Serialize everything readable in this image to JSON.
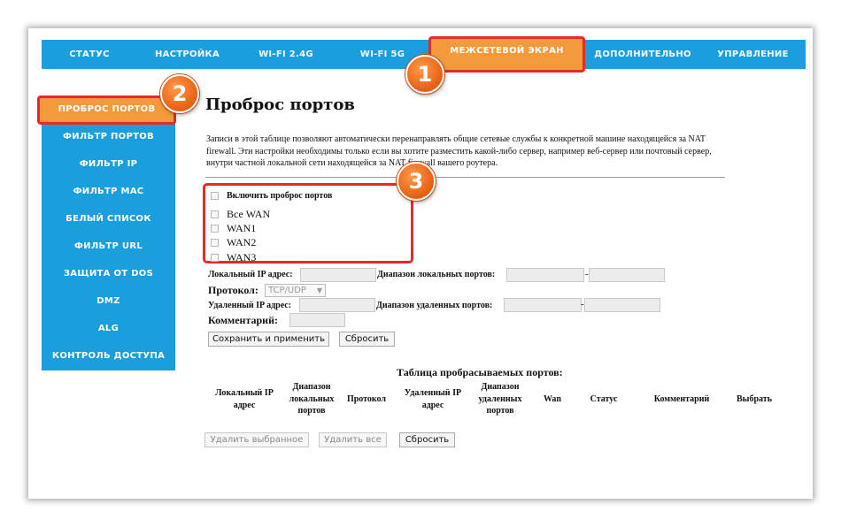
{
  "topnav": {
    "tabs": [
      {
        "label": "СТАТУС"
      },
      {
        "label": "НАСТРОЙКА"
      },
      {
        "label": "WI-FI 2.4G"
      },
      {
        "label": "WI-FI 5G"
      },
      {
        "label": "МЕЖСЕТЕВОЙ ЭКРАН"
      },
      {
        "label": "ДОПОЛНИТЕЛЬНО"
      },
      {
        "label": "УПРАВЛЕНИЕ"
      }
    ]
  },
  "sidebar": {
    "items": [
      {
        "label": "ПРОБРОС ПОРТОВ"
      },
      {
        "label": "ФИЛЬТР ПОРТОВ"
      },
      {
        "label": "ФИЛЬТР IP"
      },
      {
        "label": "ФИЛЬТР MAC"
      },
      {
        "label": "БЕЛЫЙ СПИСОК"
      },
      {
        "label": "ФИЛЬТР URL"
      },
      {
        "label": "ЗАЩИТА ОТ DOS"
      },
      {
        "label": "DMZ"
      },
      {
        "label": "ALG"
      },
      {
        "label": "КОНТРОЛЬ ДОСТУПА"
      }
    ]
  },
  "badges": [
    "1",
    "2",
    "3"
  ],
  "main": {
    "title": "Проброс портов",
    "description": "Записи в этой таблице позволяют автоматически перенаправлять общие сетевые службы  к конкретной машине находящейся за NAT firewall. Эти настройки необходимы только  если вы хотите разместить какой-либо сервер, например веб-сервер или почтовый сервер, внутри частной локальной сети находящейся за NAT firewall вашего роутера.",
    "enable_label": "Включить проброс портов",
    "wan_options": [
      "Все WAN",
      "WAN1",
      "WAN2",
      "WAN3"
    ],
    "local_ip_label": "Локальный IP адрес:",
    "local_ports_label": "Диапазон локальных портов:",
    "protocol_label": "Протокол:",
    "protocol_value": "TCP/UDP",
    "remote_ip_label": "Удаленный IP адрес:",
    "remote_ports_label": "Диапазон удаленных портов:",
    "comment_label": "Комментарий:",
    "range_dash": "-",
    "save_button": "Сохранить и применить",
    "reset_button": "Сбросить"
  },
  "table": {
    "title": "Таблица пробрасываемых портов:",
    "headers": [
      "Локальный IP адрес",
      "Диапазон локальных портов",
      "Протокол",
      "Удаленный IP адрес",
      "Диапазон удаленных портов",
      "Wan",
      "Статус",
      "Комментарий",
      "Выбрать"
    ],
    "delete_selected": "Удалить выбранное",
    "delete_all": "Удалить все",
    "reset": "Сбросить"
  },
  "colors": {
    "nav_blue": "#1a9edc",
    "active_orange": "#f39a3c",
    "highlight_red": "#e32b2b",
    "badge_orange": "#e85e10"
  }
}
